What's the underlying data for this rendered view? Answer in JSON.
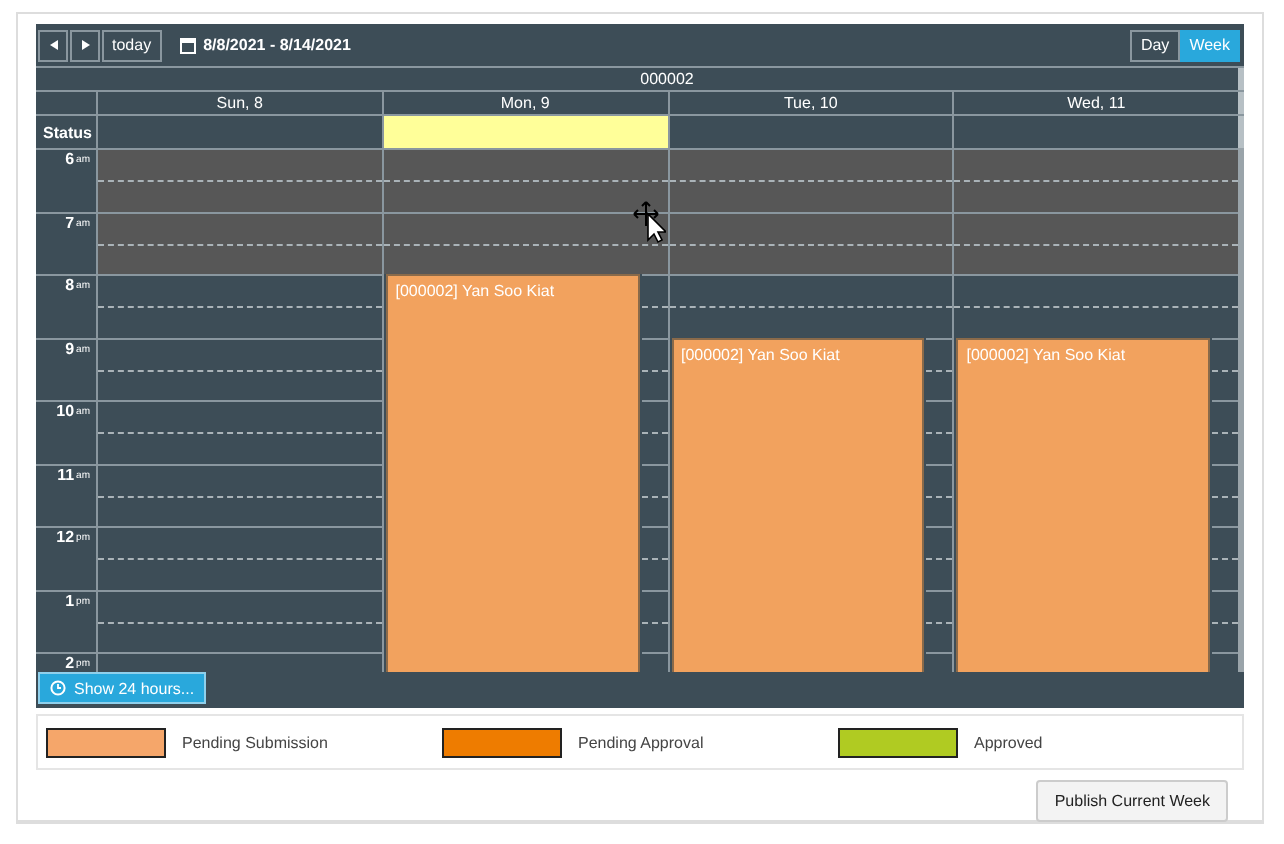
{
  "toolbar": {
    "nav_buttons": [
      {
        "kind": "prev"
      },
      {
        "kind": "next"
      }
    ],
    "today": "today",
    "date_range": "8/8/2021 - 8/14/2021",
    "views": [
      {
        "label": "Day",
        "selected": false
      },
      {
        "label": "Week",
        "selected": true
      }
    ]
  },
  "resource": "000002",
  "status_label": "Status",
  "days": [
    {
      "label": "Sun, 8"
    },
    {
      "label": "Mon, 9",
      "status": {
        "color": "#ffff99"
      }
    },
    {
      "label": "Tue, 10"
    },
    {
      "label": "Wed, 11"
    }
  ],
  "hours": [
    {
      "hour": "6",
      "period": "am",
      "nonworking": true,
      "cells": [
        {
          "kind": "slot"
        },
        {
          "kind": "slot"
        },
        {
          "kind": "slot"
        },
        {
          "kind": "slot"
        }
      ]
    },
    {
      "hour": "7",
      "period": "am",
      "nonworking": true,
      "cells": [
        {
          "kind": "slot"
        },
        {
          "kind": "slot"
        },
        {
          "kind": "slot"
        },
        {
          "kind": "slot"
        }
      ]
    },
    {
      "hour": "8",
      "period": "am",
      "nonworking": false,
      "cells": [
        {
          "kind": "slot"
        },
        {
          "kind": "event",
          "title": "[000002] Yan Soo Kiat",
          "color": "#f2a25e"
        },
        {
          "kind": "slot"
        },
        {
          "kind": "slot"
        }
      ]
    },
    {
      "hour": "9",
      "period": "am",
      "nonworking": false,
      "cells": [
        {
          "kind": "slot"
        },
        {
          "kind": "slot"
        },
        {
          "kind": "event",
          "title": "[000002] Yan Soo Kiat",
          "color": "#f2a25e"
        },
        {
          "kind": "event",
          "title": "[000002] Yan Soo Kiat",
          "color": "#f2a25e"
        }
      ]
    },
    {
      "hour": "10",
      "period": "am",
      "nonworking": false,
      "cells": [
        {
          "kind": "slot"
        },
        {
          "kind": "slot"
        },
        {
          "kind": "slot"
        },
        {
          "kind": "slot"
        }
      ]
    },
    {
      "hour": "11",
      "period": "am",
      "nonworking": false,
      "cells": [
        {
          "kind": "slot"
        },
        {
          "kind": "slot"
        },
        {
          "kind": "slot"
        },
        {
          "kind": "slot"
        }
      ]
    },
    {
      "hour": "12",
      "period": "pm",
      "nonworking": false,
      "cells": [
        {
          "kind": "slot"
        },
        {
          "kind": "slot"
        },
        {
          "kind": "slot"
        },
        {
          "kind": "slot"
        }
      ]
    },
    {
      "hour": "1",
      "period": "pm",
      "nonworking": false,
      "cells": [
        {
          "kind": "slot"
        },
        {
          "kind": "slot"
        },
        {
          "kind": "slot"
        },
        {
          "kind": "slot"
        }
      ]
    },
    {
      "hour": "2",
      "period": "pm",
      "nonworking": false,
      "cells": [
        {
          "kind": "slot"
        },
        {
          "kind": "slot"
        },
        {
          "kind": "slot"
        },
        {
          "kind": "slot"
        }
      ]
    }
  ],
  "show_hours_button": "Show 24 hours...",
  "legend": [
    {
      "label": "Pending Submission",
      "color": "#f5a66a"
    },
    {
      "label": "Pending Approval",
      "color": "#ee7c00"
    },
    {
      "label": "Approved",
      "color": "#b0cb22"
    }
  ],
  "publish_button": "Publish Current Week"
}
